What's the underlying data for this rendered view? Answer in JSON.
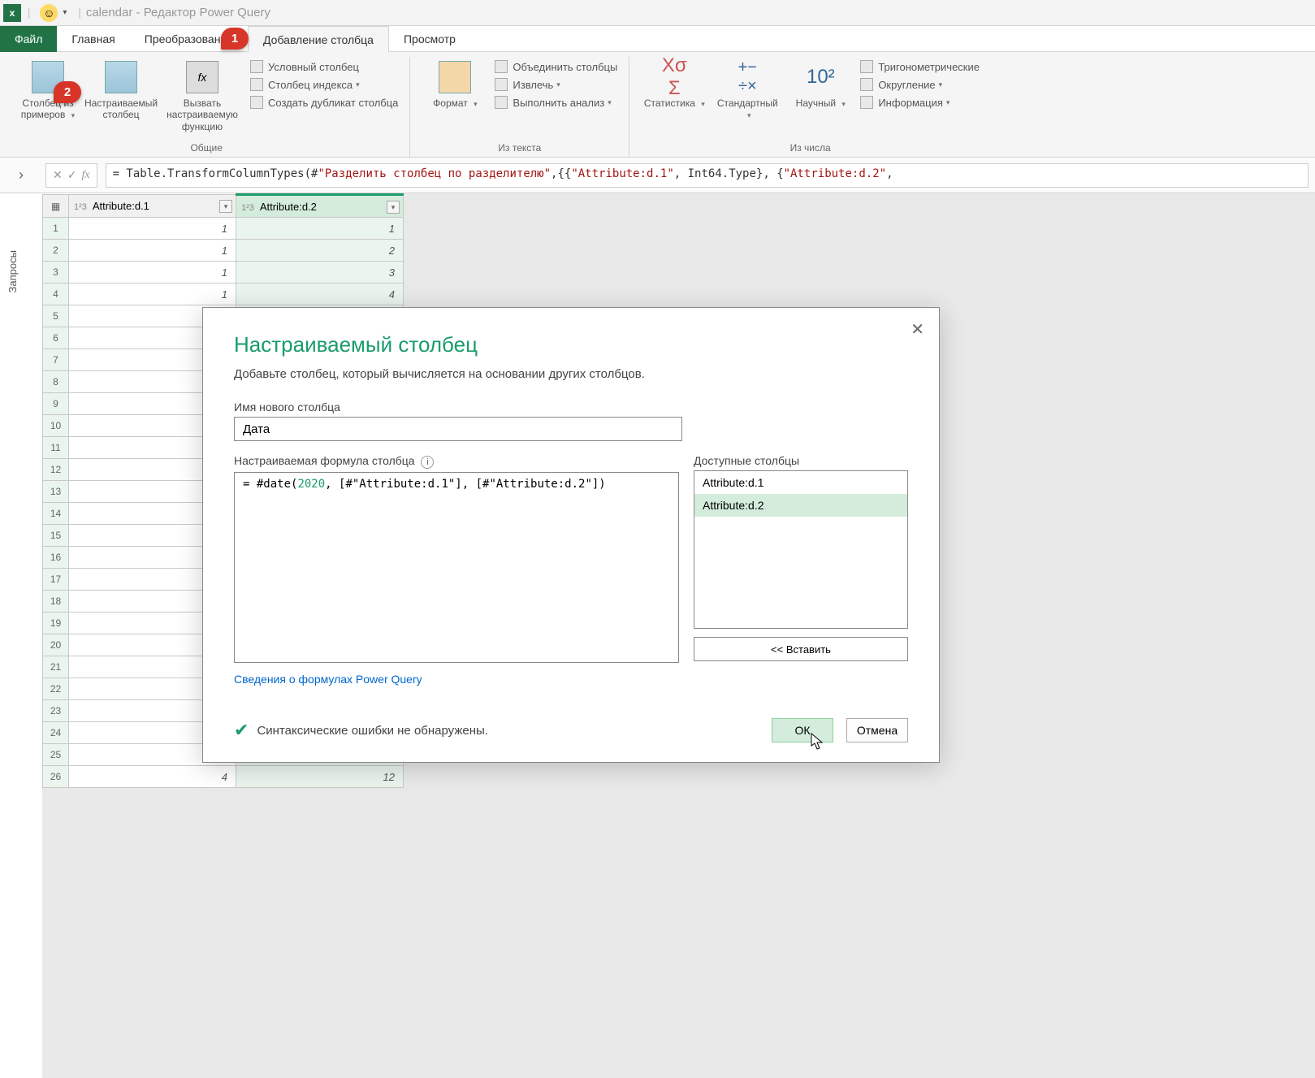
{
  "title": {
    "app_name": "calendar",
    "suffix": "Редактор Power Query"
  },
  "tabs": {
    "file": "Файл",
    "home": "Главная",
    "transform": "Преобразование",
    "add_column": "Добавление столбца",
    "view": "Просмотр"
  },
  "ribbon": {
    "general": {
      "label": "Общие",
      "col_from_examples": "Столбец из примеров",
      "custom_column": "Настраиваемый столбец",
      "invoke_custom_fn": "Вызвать настраиваемую функцию",
      "conditional_col": "Условный столбец",
      "index_col": "Столбец индекса",
      "duplicate_col": "Создать дубликат столбца"
    },
    "text": {
      "label": "Из текста",
      "format": "Формат",
      "merge": "Объединить столбцы",
      "extract": "Извлечь",
      "parse": "Выполнить анализ"
    },
    "number": {
      "label": "Из числа",
      "statistics": "Статистика",
      "standard": "Стандартный",
      "scientific": "Научный",
      "trig": "Тригонометрические",
      "rounding": "Округление",
      "information": "Информация"
    }
  },
  "callouts": {
    "one": "1",
    "two": "2"
  },
  "formula_bar": {
    "prefix": "= Table.TransformColumnTypes(#",
    "str1": "\"Разделить столбец по разделителю\"",
    "mid1": ",{{",
    "str2": "\"Attribute:d.1\"",
    "mid2": ", Int64.Type}, {",
    "str3": "\"Attribute:d.2\"",
    "suffix": ","
  },
  "queries_label": "Запросы",
  "grid": {
    "col1": "Attribute:d.1",
    "col2": "Attribute:d.2",
    "col_type": "1²3",
    "rows": [
      {
        "n": "1",
        "a": "1",
        "b": "1"
      },
      {
        "n": "2",
        "a": "1",
        "b": "2"
      },
      {
        "n": "3",
        "a": "1",
        "b": "3"
      },
      {
        "n": "4",
        "a": "1",
        "b": "4"
      },
      {
        "n": "5",
        "a": "",
        "b": ""
      },
      {
        "n": "6",
        "a": "",
        "b": ""
      },
      {
        "n": "7",
        "a": "",
        "b": ""
      },
      {
        "n": "8",
        "a": "",
        "b": ""
      },
      {
        "n": "9",
        "a": "",
        "b": ""
      },
      {
        "n": "10",
        "a": "",
        "b": ""
      },
      {
        "n": "11",
        "a": "",
        "b": ""
      },
      {
        "n": "12",
        "a": "",
        "b": ""
      },
      {
        "n": "13",
        "a": "",
        "b": ""
      },
      {
        "n": "14",
        "a": "",
        "b": ""
      },
      {
        "n": "15",
        "a": "",
        "b": ""
      },
      {
        "n": "16",
        "a": "",
        "b": ""
      },
      {
        "n": "17",
        "a": "",
        "b": ""
      },
      {
        "n": "18",
        "a": "",
        "b": ""
      },
      {
        "n": "19",
        "a": "",
        "b": ""
      },
      {
        "n": "20",
        "a": "",
        "b": ""
      },
      {
        "n": "21",
        "a": "",
        "b": ""
      },
      {
        "n": "22",
        "a": "",
        "b": ""
      },
      {
        "n": "23",
        "a": "",
        "b": ""
      },
      {
        "n": "24",
        "a": "",
        "b": ""
      },
      {
        "n": "25",
        "a": "",
        "b": ""
      },
      {
        "n": "26",
        "a": "4",
        "b": "12"
      }
    ]
  },
  "dialog": {
    "title": "Настраиваемый столбец",
    "subtitle": "Добавьте столбец, который вычисляется на основании других столбцов.",
    "name_label": "Имя нового столбца",
    "name_value": "Дата",
    "formula_label": "Настраиваемая формула столбца",
    "formula_prefix": "= #date(",
    "formula_year": "2020",
    "formula_rest": ", [#\"Attribute:d.1\"], [#\"Attribute:d.2\"])",
    "avail_label": "Доступные столбцы",
    "avail_items": [
      "Attribute:d.1",
      "Attribute:d.2"
    ],
    "insert_btn": "<< Вставить",
    "help_link": "Сведения о формулах Power Query",
    "status_ok": "Синтаксические ошибки не обнаружены.",
    "ok": "ОК",
    "cancel": "Отмена"
  }
}
